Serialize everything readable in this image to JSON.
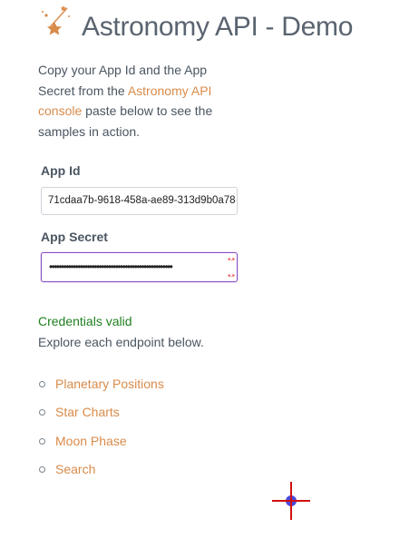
{
  "header": {
    "title": "Astronomy API - Demo",
    "logo_icon": "shooting-stars-icon"
  },
  "intro": {
    "text_before": "Copy your App Id and the App Secret from the ",
    "link_text": "Astronomy API console",
    "text_after": " paste below to see the samples in action."
  },
  "form": {
    "app_id_label": "App Id",
    "app_id_value": "71cdaa7b-9618-458a-ae89-313d9b0a78",
    "app_secret_label": "App Secret",
    "app_secret_masked": "••••••••••••••••••••••••••••••••••••••••••••••••••••",
    "reveal_icon": "password-reveal-icon"
  },
  "status": {
    "message": "Credentials valid",
    "explore": "Explore each endpoint below."
  },
  "endpoints": [
    {
      "label": "Planetary Positions"
    },
    {
      "label": "Star Charts"
    },
    {
      "label": "Moon Phase"
    },
    {
      "label": "Search"
    }
  ],
  "colors": {
    "link": "#d98b4a",
    "success": "#208020",
    "focus_border": "#8a4fc4",
    "text": "#4a5561"
  },
  "cursor_icon": "crosshair-cursor-icon"
}
